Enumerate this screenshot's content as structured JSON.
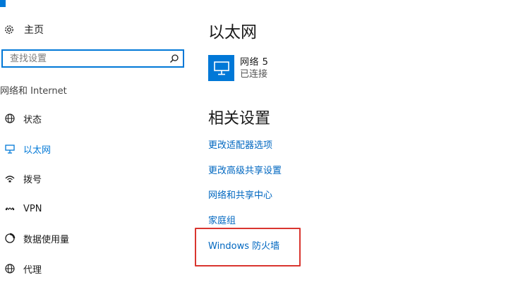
{
  "sidebar": {
    "home_label": "主页",
    "search_placeholder": "查找设置",
    "section_title": "网络和 Internet",
    "items": [
      {
        "label": "状态",
        "icon": "globe-status-icon",
        "active": false
      },
      {
        "label": "以太网",
        "icon": "ethernet-icon",
        "active": true
      },
      {
        "label": "拨号",
        "icon": "dialup-icon",
        "active": false
      },
      {
        "label": "VPN",
        "icon": "vpn-icon",
        "active": false
      },
      {
        "label": "数据使用量",
        "icon": "data-usage-icon",
        "active": false
      },
      {
        "label": "代理",
        "icon": "proxy-globe-icon",
        "active": false
      }
    ]
  },
  "main": {
    "title": "以太网",
    "network": {
      "name": "网络  5",
      "status": "已连接"
    },
    "related_title": "相关设置",
    "links": [
      "更改适配器选项",
      "更改高级共享设置",
      "网络和共享中心",
      "家庭组",
      "Windows 防火墙"
    ]
  },
  "colors": {
    "accent": "#0078d7",
    "link": "#0067c0",
    "highlight_box": "#d9352f"
  }
}
